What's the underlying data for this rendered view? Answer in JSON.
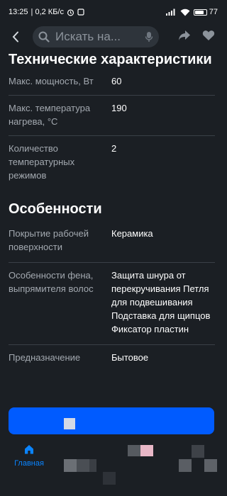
{
  "status_bar": {
    "time": "13:25",
    "speed": "| 0,2 КБ/с",
    "battery": "77",
    "battery_level": 0.77
  },
  "top_bar": {
    "search_placeholder": "Искать на..."
  },
  "sections": [
    {
      "title": "Технические характеристики",
      "rows": [
        {
          "label": "Макс. мощность, Вт",
          "value": "60"
        },
        {
          "label": "Макс. температура нагрева, °С",
          "value": "190"
        },
        {
          "label": "Количество температурных режимов",
          "value": "2"
        }
      ]
    },
    {
      "title": "Особенности",
      "rows": [
        {
          "label": "Покрытие рабочей поверхности",
          "value": "Керамика"
        },
        {
          "label": "Особенности фена, выпрямителя волос",
          "value": "Защита шнура от перекручивания Петля для подвешивания Подставка для щипцов Фиксатор пластин"
        },
        {
          "label": "Предназначение",
          "value": "Бытовое"
        }
      ]
    }
  ],
  "bottom_nav": {
    "home_label": "Главная"
  },
  "colors": {
    "background": "#1b1f24",
    "accent_blue": "#005bff",
    "home_active": "#0a84ff"
  }
}
